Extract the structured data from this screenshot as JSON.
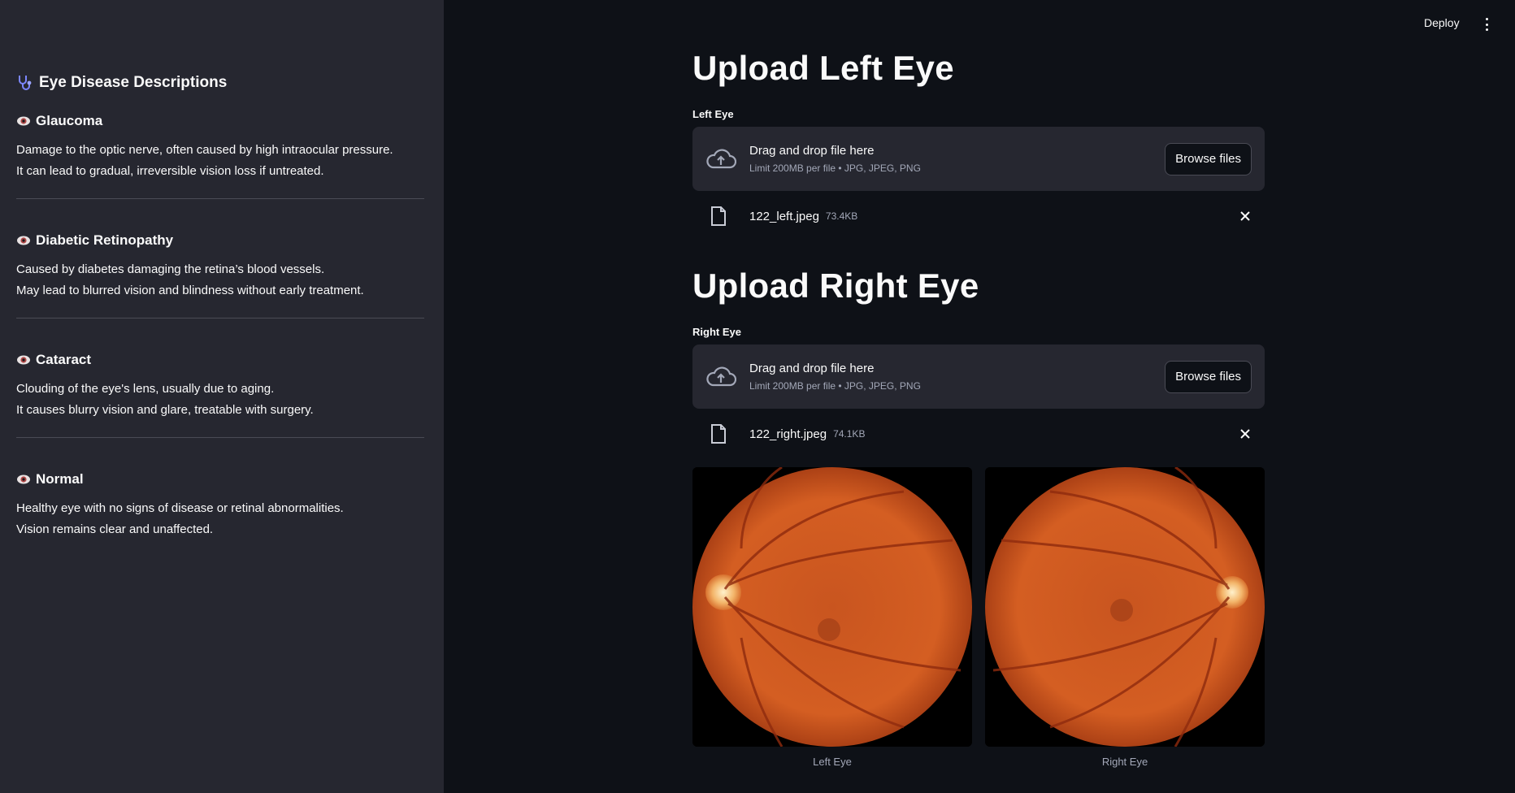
{
  "sidebar": {
    "title": "Eye Disease Descriptions",
    "diseases": [
      {
        "name": "Glaucoma",
        "line1": "Damage to the optic nerve, often caused by high intraocular pressure.",
        "line2": "It can lead to gradual, irreversible vision loss if untreated."
      },
      {
        "name": "Diabetic Retinopathy",
        "line1": "Caused by diabetes damaging the retina’s blood vessels.",
        "line2": "May lead to blurred vision and blindness without early treatment."
      },
      {
        "name": "Cataract",
        "line1": "Clouding of the eye's lens, usually due to aging.",
        "line2": "It causes blurry vision and glare, treatable with surgery."
      },
      {
        "name": "Normal",
        "line1": "Healthy eye with no signs of disease or retinal abnormalities.",
        "line2": "Vision remains clear and unaffected."
      }
    ]
  },
  "header": {
    "deploy_label": "Deploy"
  },
  "left": {
    "heading": "Upload Left Eye",
    "label": "Left Eye",
    "dropzone_title": "Drag and drop file here",
    "dropzone_limit": "Limit 200MB per file • JPG, JPEG, PNG",
    "browse_label": "Browse files",
    "file_name": "122_left.jpeg",
    "file_size": "73.4KB",
    "caption": "Left Eye"
  },
  "right": {
    "heading": "Upload Right Eye",
    "label": "Right Eye",
    "dropzone_title": "Drag and drop file here",
    "dropzone_limit": "Limit 200MB per file • JPG, JPEG, PNG",
    "browse_label": "Browse files",
    "file_name": "122_right.jpeg",
    "file_size": "74.1KB",
    "caption": "Right Eye"
  },
  "colors": {
    "background": "#0e1117",
    "sidebar": "#262730",
    "accent_icon": "#7b86ff",
    "fundus": "#d2581f"
  }
}
